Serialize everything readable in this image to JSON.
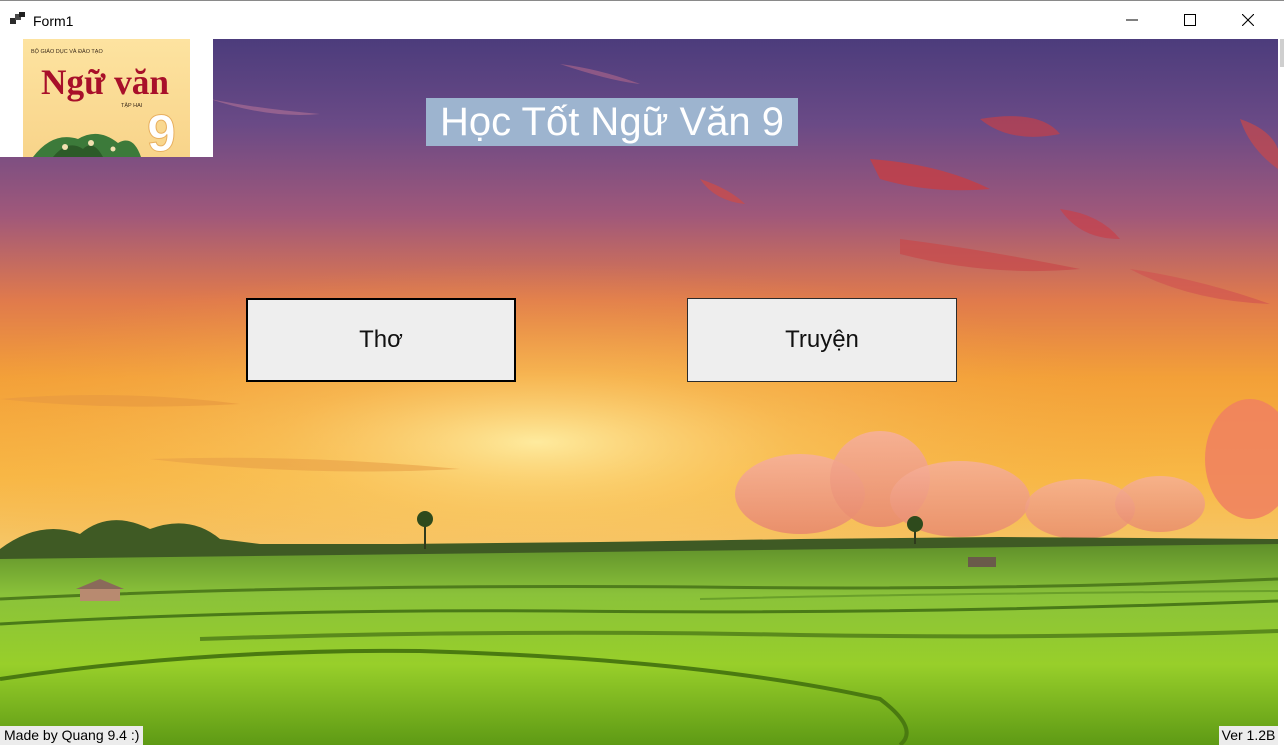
{
  "window": {
    "title": "Form1",
    "icon": "form-app-icon",
    "controls": [
      "minimize-icon",
      "maximize-icon",
      "close-icon"
    ]
  },
  "cover": {
    "publisher": "BỘ GIÁO DỤC VÀ ĐÀO TẠO",
    "title": "Ngữ văn",
    "volume": "TẬP HAI",
    "grade": "9"
  },
  "main": {
    "heading": "Học Tốt Ngữ Văn 9",
    "buttons": {
      "poetry": "Thơ",
      "stories": "Truyện"
    }
  },
  "footer": {
    "credit": "Made by Quang 9.4 :)",
    "version": "Ver 1.2B"
  },
  "colors": {
    "heading_bg": "#9db4cf",
    "button_bg": "#eeeeee",
    "sky_top": "#4a3a7a",
    "sky_mid": "#f2a23a",
    "field_green": "#7fc72a"
  }
}
